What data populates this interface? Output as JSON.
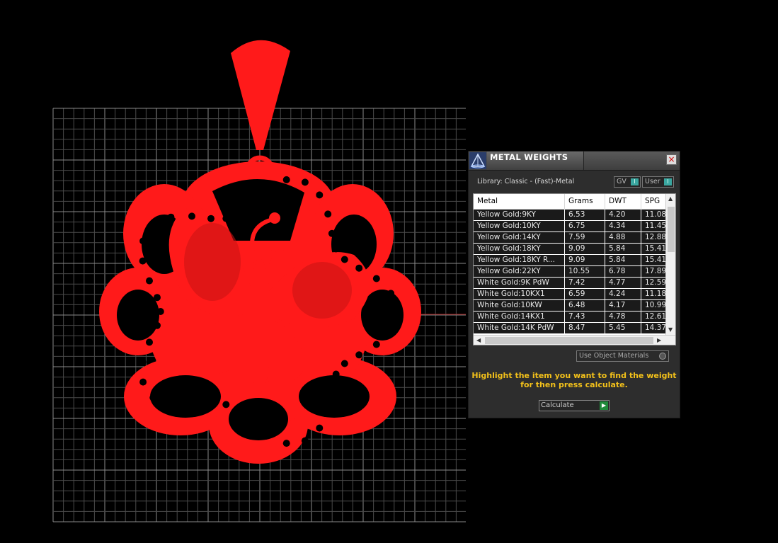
{
  "panel": {
    "title": "METAL WEIGHTS",
    "close_glyph": "×",
    "library_text": "Library: Classic - (Fast)-Metal",
    "toggle_gv": "GV",
    "toggle_user": "User",
    "toggle_indicator": "I",
    "use_object_materials": "Use Object Materials",
    "hint_line1": "Highlight the item you want to find the weight",
    "hint_line2": "for then press calculate.",
    "calculate_label": "Calculate",
    "calculate_glyph": "▶"
  },
  "table": {
    "headers": [
      "Metal",
      "Grams",
      "DWT",
      "SPG"
    ],
    "rows": [
      [
        "Yellow Gold:9KY",
        "6.53",
        "4.20",
        "11.08"
      ],
      [
        "Yellow Gold:10KY",
        "6.75",
        "4.34",
        "11.45"
      ],
      [
        "Yellow Gold:14KY",
        "7.59",
        "4.88",
        "12.88"
      ],
      [
        "Yellow Gold:18KY",
        "9.09",
        "5.84",
        "15.41"
      ],
      [
        "Yellow Gold:18KY R...",
        "9.09",
        "5.84",
        "15.41"
      ],
      [
        "Yellow Gold:22KY",
        "10.55",
        "6.78",
        "17.89"
      ],
      [
        "White Gold:9K PdW",
        "7.42",
        "4.77",
        "12.59"
      ],
      [
        "White Gold:10KX1",
        "6.59",
        "4.24",
        "11.18"
      ],
      [
        "White Gold:10KW",
        "6.48",
        "4.17",
        "10.99"
      ],
      [
        "White Gold:14KX1",
        "7.43",
        "4.78",
        "12.61"
      ],
      [
        "White Gold:14K PdW",
        "8.47",
        "5.45",
        "14.37"
      ]
    ]
  },
  "colors": {
    "model_red": "#ff1a1a",
    "grid_line": "#5a5a5a",
    "hint_yellow": "#f3c11a",
    "toggle_teal": "#3aa7a0"
  },
  "icons": {
    "logo": "pyramid-logo-icon",
    "close": "close-icon",
    "calculate": "play-arrow-icon"
  }
}
